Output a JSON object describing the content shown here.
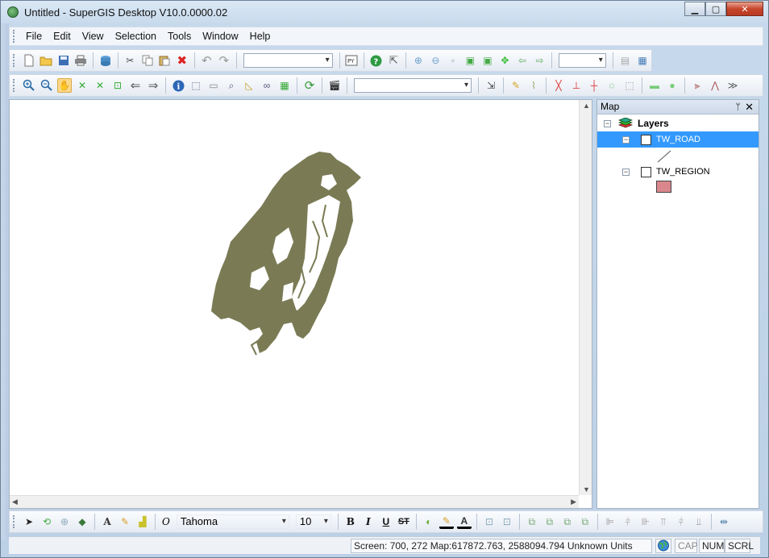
{
  "window": {
    "title": "Untitled - SuperGIS Desktop V10.0.0000.02",
    "minimize": "▁",
    "maximize": "▢",
    "close": "✕"
  },
  "menu": [
    "File",
    "Edit",
    "View",
    "Selection",
    "Tools",
    "Window",
    "Help"
  ],
  "toolbar_combo_values": {
    "scale": "",
    "zoom": "",
    "layer_target": ""
  },
  "format_toolbar": {
    "font_italic_glyph": "O",
    "font": "Tahoma",
    "font_size": "10",
    "bold": "B",
    "italic": "I",
    "underline": "U",
    "strikethrough": "ST"
  },
  "panel": {
    "title": "Map",
    "pin": "ᛘ",
    "close": "✕",
    "root_label": "Layers",
    "layers": [
      {
        "name": "TW_ROAD",
        "checked": true,
        "selected": true,
        "symbol": "line"
      },
      {
        "name": "TW_REGION",
        "checked": false,
        "selected": false,
        "symbol": "fill",
        "fill_color": "#d9878d"
      }
    ]
  },
  "map": {
    "feature_color": "#7a7a55"
  },
  "status": {
    "coords": "Screen: 700, 272  Map:617872.763, 2588094.794 Unknown Units",
    "cap": "CAP",
    "num": "NUM",
    "scrl": "SCRL"
  }
}
